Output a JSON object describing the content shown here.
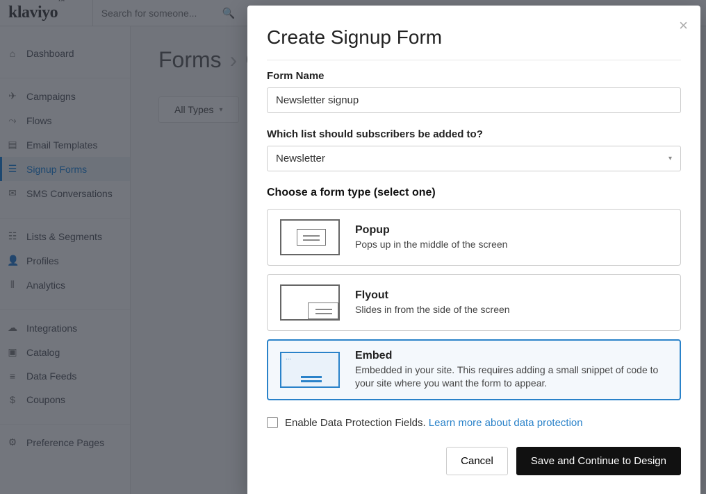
{
  "topbar": {
    "logo": "klaviyo",
    "search_placeholder": "Search for someone..."
  },
  "sidebar": {
    "groups": [
      [
        {
          "label": "Dashboard",
          "icon": "⌂"
        }
      ],
      [
        {
          "label": "Campaigns",
          "icon": "✈"
        },
        {
          "label": "Flows",
          "icon": "⤳"
        },
        {
          "label": "Email Templates",
          "icon": "▤"
        },
        {
          "label": "Signup Forms",
          "icon": "☰",
          "active": true
        },
        {
          "label": "SMS Conversations",
          "icon": "✉"
        }
      ],
      [
        {
          "label": "Lists & Segments",
          "icon": "☷"
        },
        {
          "label": "Profiles",
          "icon": "👤"
        },
        {
          "label": "Analytics",
          "icon": "⫴"
        }
      ],
      [
        {
          "label": "Integrations",
          "icon": "☁"
        },
        {
          "label": "Catalog",
          "icon": "▣"
        },
        {
          "label": "Data Feeds",
          "icon": "≡"
        },
        {
          "label": "Coupons",
          "icon": "$"
        }
      ],
      [
        {
          "label": "Preference Pages",
          "icon": "⚙"
        }
      ]
    ]
  },
  "content": {
    "breadcrumb": [
      "Forms",
      "C"
    ],
    "tab_all": "All Types"
  },
  "modal": {
    "title": "Create Signup Form",
    "form_name_label": "Form Name",
    "form_name_value": "Newsletter signup",
    "list_label": "Which list should subscribers be added to?",
    "list_value": "Newsletter",
    "formtype_label": "Choose a form type (select one)",
    "options": [
      {
        "title": "Popup",
        "desc": "Pops up in the middle of the screen",
        "selected": false,
        "thumb": "popup"
      },
      {
        "title": "Flyout",
        "desc": "Slides in from the side of the screen",
        "selected": false,
        "thumb": "flyout"
      },
      {
        "title": "Embed",
        "desc": "Embedded in your site. This requires adding a small snippet of code to your site where you want the form to appear.",
        "selected": true,
        "thumb": "embed"
      }
    ],
    "checkbox_label": "Enable Data Protection Fields.",
    "checkbox_link": "Learn more about data protection",
    "cancel": "Cancel",
    "save": "Save and Continue to Design"
  }
}
